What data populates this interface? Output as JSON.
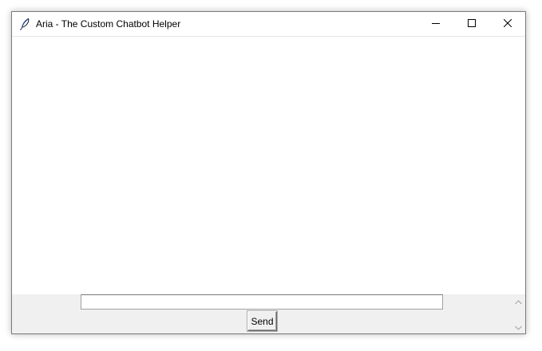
{
  "window": {
    "title": "Aria - The Custom Chatbot Helper"
  },
  "titlebar": {
    "app_icon": "feather-icon",
    "minimize_icon": "minimize-icon",
    "maximize_icon": "maximize-icon",
    "close_icon": "close-icon"
  },
  "chat": {
    "messages": []
  },
  "input": {
    "value": "",
    "placeholder": ""
  },
  "send_button": {
    "label": "Send"
  },
  "scrollbar": {
    "up_icon": "scroll-up-arrow-icon",
    "down_icon": "scroll-down-arrow-icon"
  },
  "colors": {
    "titlebar_bg": "#ffffff",
    "panel_bg": "#f0f0f0",
    "chat_bg": "#ffffff",
    "border": "#7a7a7a"
  }
}
